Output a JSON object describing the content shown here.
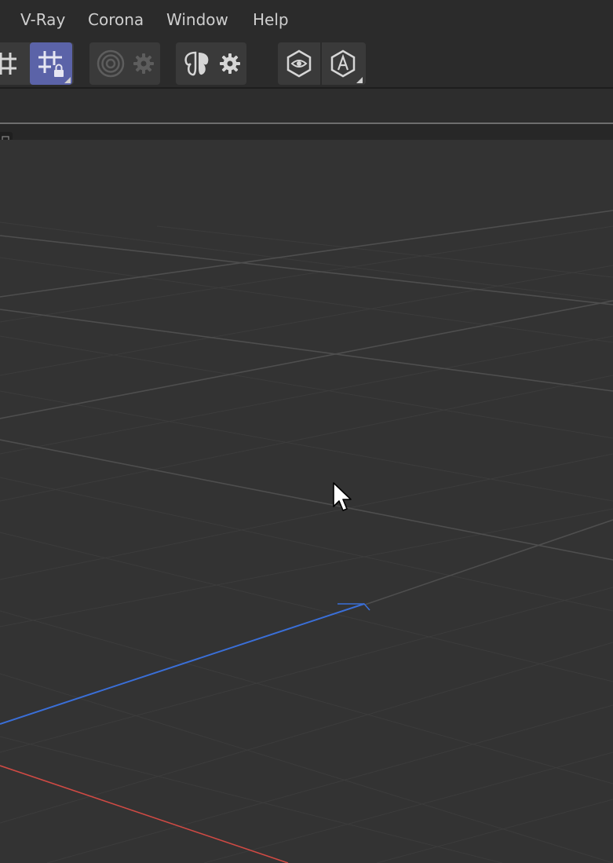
{
  "menu": {
    "items": [
      "V-Ray",
      "Corona",
      "Window",
      "Help"
    ]
  },
  "toolbar": {
    "buttons": [
      {
        "icon": "grid-snap-icon",
        "active": false
      },
      {
        "icon": "grid-lock-icon",
        "active": true
      },
      {
        "icon": "radial-target-icon",
        "active": false,
        "disabled": true
      },
      {
        "icon": "gear-icon",
        "active": false,
        "disabled": true
      },
      {
        "icon": "butterfly-symmetry-icon",
        "active": false
      },
      {
        "icon": "gear-icon",
        "active": false
      },
      {
        "icon": "hexagon-eye-icon",
        "active": false
      },
      {
        "icon": "hexagon-a-icon",
        "active": false
      }
    ]
  },
  "colors": {
    "background": "#333333",
    "bar": "#2b2b2b",
    "accent_active": "#5b63a8",
    "axis_blue": "#3a6fd8",
    "axis_red": "#d04a44",
    "grid_minor": "#3d3d3d",
    "grid_major": "#4a4a4a",
    "text": "#cfcfcf"
  },
  "viewport": {
    "type": "3d-perspective-grid",
    "axes": [
      "z-blue",
      "x-red"
    ]
  }
}
